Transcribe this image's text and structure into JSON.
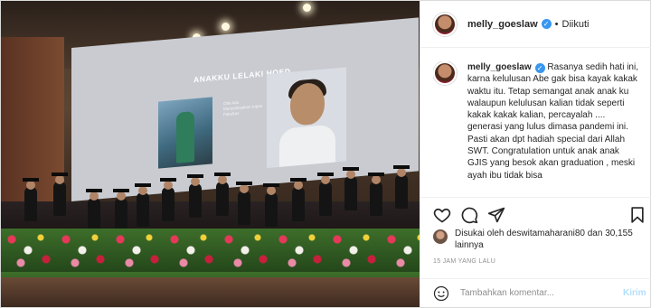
{
  "post": {
    "photo_alt": "",
    "screen_title": "ANAKKU LELAKI HOED",
    "screen_caption": "Olik Ada\nMenyelesaikan tugas\nFakultas"
  },
  "header": {
    "username": "melly_goeslaw",
    "separator": "•",
    "follow_status": "Diikuti"
  },
  "caption": {
    "username": "melly_goeslaw",
    "text": "Rasanya sedih hati ini, karna kelulusan Abe gak bisa kayak kakak waktu itu. Tetap semangat anak anak ku walaupun kelulusan kalian tidak seperti kakak kakak kalian, percayalah .... generasi yang lulus dimasa pandemi ini. Pasti akan dpt hadiah special dari Allah SWT. Congratulation untuk anak anak GJIS yang besok akan graduation , meski ayah ibu tidak bisa"
  },
  "likes": {
    "text": "Disukai oleh deswitamaharani80 dan 30,155 lainnya"
  },
  "timestamp": "15 JAM YANG LALU",
  "comment": {
    "placeholder": "Tambahkan komentar...",
    "send_label": "Kirim"
  },
  "colors": {
    "verified": "#3897f0",
    "send_disabled": "#b2dffc",
    "border": "#efefef"
  }
}
